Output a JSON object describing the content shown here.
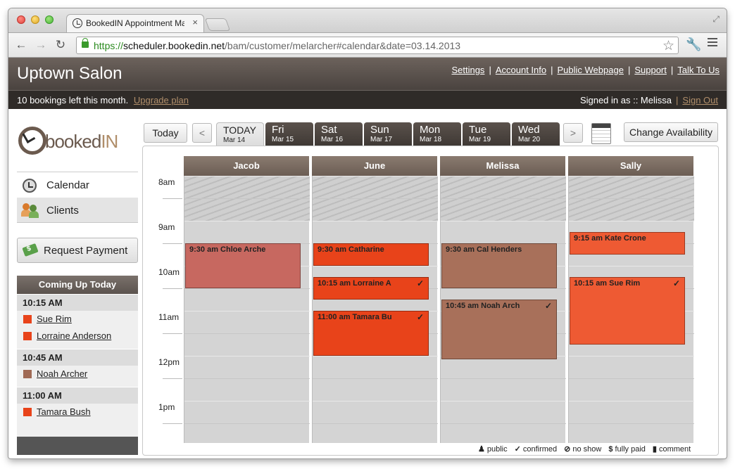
{
  "browser": {
    "tab_title": "BookedIN Appointment Ma",
    "tab_close": "×",
    "url_scheme": "https://",
    "url_host": "scheduler.bookedin.net",
    "url_path": "/bam/customer/melarcher#calendar&date=03.14.2013"
  },
  "header": {
    "site_title": "Uptown Salon",
    "links": [
      "Settings",
      "Account Info",
      "Public Webpage",
      "Support",
      "Talk To Us"
    ],
    "separator": "|"
  },
  "status": {
    "bookings_left": "10 bookings left this month.",
    "upgrade": "Upgrade plan",
    "signed_in": "Signed in as :: Melissa",
    "separator": "|",
    "sign_out": "Sign Out"
  },
  "sidebar": {
    "logo_text_a": "booked",
    "logo_text_b": "IN",
    "nav": [
      "Calendar",
      "Clients"
    ],
    "request_payment": "Request Payment",
    "coming_up_title": "Coming Up Today",
    "coming_up": [
      {
        "time": "10:15 AM",
        "clients": [
          {
            "name": "Sue Rim",
            "color": "#e8431a"
          },
          {
            "name": "Lorraine Anderson",
            "color": "#e8431a"
          }
        ]
      },
      {
        "time": "10:45 AM",
        "clients": [
          {
            "name": "Noah Archer",
            "color": "#a06a55"
          }
        ]
      },
      {
        "time": "11:00 AM",
        "clients": [
          {
            "name": "Tamara Bush",
            "color": "#e8431a"
          }
        ]
      }
    ]
  },
  "calendar_nav": {
    "today_button": "Today",
    "prev": "<",
    "next": ">",
    "change_availability": "Change Availability",
    "days": [
      {
        "name": "TODAY",
        "date": "Mar 14",
        "active": true
      },
      {
        "name": "Fri",
        "date": "Mar 15"
      },
      {
        "name": "Sat",
        "date": "Mar 16"
      },
      {
        "name": "Sun",
        "date": "Mar 17"
      },
      {
        "name": "Mon",
        "date": "Mar 18"
      },
      {
        "name": "Tue",
        "date": "Mar 19"
      },
      {
        "name": "Wed",
        "date": "Mar 20"
      }
    ]
  },
  "schedule": {
    "staff": [
      "Jacob",
      "June",
      "Melissa",
      "Sally"
    ],
    "times": [
      "8am",
      "9am",
      "10am",
      "11am",
      "12pm",
      "1pm"
    ],
    "appointments": [
      {
        "staff": "Jacob",
        "label": "9:30 am Chloe Arche",
        "start": "9:30",
        "end": "10:30",
        "color": "#c76860",
        "confirmed": false
      },
      {
        "staff": "June",
        "label": "9:30 am Catharine",
        "start": "9:30",
        "end": "10:00",
        "color": "#e8431a",
        "confirmed": false
      },
      {
        "staff": "June",
        "label": "10:15 am Lorraine A",
        "start": "10:15",
        "end": "10:45",
        "color": "#e8431a",
        "confirmed": true
      },
      {
        "staff": "June",
        "label": "11:00 am Tamara Bu",
        "start": "11:00",
        "end": "12:00",
        "color": "#e8431a",
        "confirmed": true
      },
      {
        "staff": "Melissa",
        "label": "9:30 am Cal Henders",
        "start": "9:30",
        "end": "10:30",
        "color": "#a8705a",
        "confirmed": false
      },
      {
        "staff": "Melissa",
        "label": "10:45 am Noah Arch",
        "start": "10:45",
        "end": "12:05",
        "color": "#a8705a",
        "confirmed": true
      },
      {
        "staff": "Sally",
        "label": "9:15 am Kate Crone",
        "start": "9:15",
        "end": "9:45",
        "color": "#ee5a33",
        "confirmed": false
      },
      {
        "staff": "Sally",
        "label": "10:15 am Sue Rim",
        "start": "10:15",
        "end": "11:45",
        "color": "#ee5a33",
        "confirmed": true
      }
    ],
    "check_glyph": "✓"
  },
  "legend": {
    "items": [
      {
        "icon": "person-icon",
        "glyph": "♟",
        "label": "public"
      },
      {
        "icon": "check-icon",
        "glyph": "✓",
        "label": "confirmed"
      },
      {
        "icon": "no-show-icon",
        "glyph": "⊘",
        "label": "no show"
      },
      {
        "icon": "dollar-icon",
        "glyph": "$",
        "label": "fully paid"
      },
      {
        "icon": "comment-icon",
        "glyph": "▮",
        "label": "comment"
      }
    ]
  }
}
